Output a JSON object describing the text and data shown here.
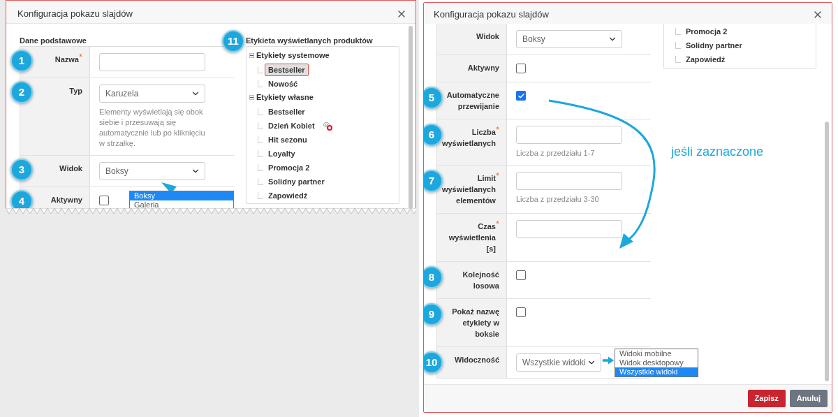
{
  "left_dialog": {
    "title": "Konfiguracja pokazu slajdów",
    "section_title": "Dane podstawowe",
    "rows": [
      {
        "kind": "text",
        "badge": "1",
        "label": "Nazwa",
        "required_mark": "*"
      },
      {
        "kind": "select",
        "badge": "2",
        "label": "Typ",
        "value": "Karuzela",
        "hint": "Elementy wyświetlają się obok siebie i przesuwają się automatycznie lub po kliknięciu w strzałkę."
      },
      {
        "kind": "select",
        "badge": "3",
        "label": "Widok",
        "value": "Boksy",
        "options": [
          {
            "label": "Boksy",
            "selected": true
          },
          {
            "label": "Galeria",
            "selected": false
          }
        ]
      },
      {
        "kind": "checkbox",
        "badge": "4",
        "label": "Aktywny",
        "checked": false
      }
    ],
    "tree": {
      "badge": "11",
      "title": "Etykieta wyświetlanych produktów",
      "groups": [
        {
          "label": "Etykiety systemowe",
          "expanded": true,
          "children": [
            {
              "label": "Bestseller",
              "selected": true,
              "hidden": false
            },
            {
              "label": "Nowość",
              "selected": false,
              "hidden": false
            }
          ]
        },
        {
          "label": "Etykiety własne",
          "expanded": true,
          "children": [
            {
              "label": "Bestseller",
              "selected": false,
              "hidden": false
            },
            {
              "label": "Dzień Kobiet",
              "selected": false,
              "hidden": true
            },
            {
              "label": "Hit sezonu",
              "selected": false,
              "hidden": false
            },
            {
              "label": "Loyalty",
              "selected": false,
              "hidden": false
            },
            {
              "label": "Promocja 2",
              "selected": false,
              "hidden": false
            },
            {
              "label": "Solidny partner",
              "selected": false,
              "hidden": false
            },
            {
              "label": "Zapowiedź",
              "selected": false,
              "hidden": false
            }
          ]
        }
      ]
    }
  },
  "right_dialog": {
    "title": "Konfiguracja pokazu slajdów",
    "rows": [
      {
        "kind": "select",
        "label": "Widok",
        "value": "Boksy"
      },
      {
        "kind": "checkbox",
        "label": "Aktywny",
        "checked": false
      },
      {
        "kind": "checkbox",
        "badge": "5",
        "label": "Automatyczne przewijanie",
        "checked": true
      },
      {
        "kind": "text",
        "badge": "6",
        "label": "Liczba wyświetlanych",
        "required_mark": "*",
        "hint": "Liczba z przedziału 1-7"
      },
      {
        "kind": "text",
        "badge": "7",
        "label": "Limit wyświetlanych elementów",
        "required_mark": "*",
        "hint": "Liczba z przedziału 3-30"
      },
      {
        "kind": "text",
        "label": "Czas wyświetlenia [s]",
        "required_mark": "*"
      },
      {
        "kind": "checkbox",
        "badge": "8",
        "label": "Kolejność losowa",
        "checked": false
      },
      {
        "kind": "checkbox",
        "badge": "9",
        "label": "Pokaż nazwę etykiety w boksie",
        "checked": false
      },
      {
        "kind": "select",
        "badge": "10",
        "label": "Widoczność",
        "value": "Wszystkie widoki",
        "options": [
          {
            "label": "Widoki mobilne",
            "selected": false
          },
          {
            "label": "Widok desktopowy",
            "selected": false
          },
          {
            "label": "Wszystkie widoki",
            "selected": true
          }
        ]
      }
    ],
    "tree_items": [
      {
        "label": "Promocja 2",
        "selected": false
      },
      {
        "label": "Solidny partner",
        "selected": false
      },
      {
        "label": "Zapowiedź",
        "selected": false
      }
    ],
    "annotation": "jeśli zaznaczone",
    "buttons": [
      {
        "kind": "primary",
        "label": "Zapisz"
      },
      {
        "kind": "secondary",
        "label": "Anuluj"
      }
    ]
  }
}
